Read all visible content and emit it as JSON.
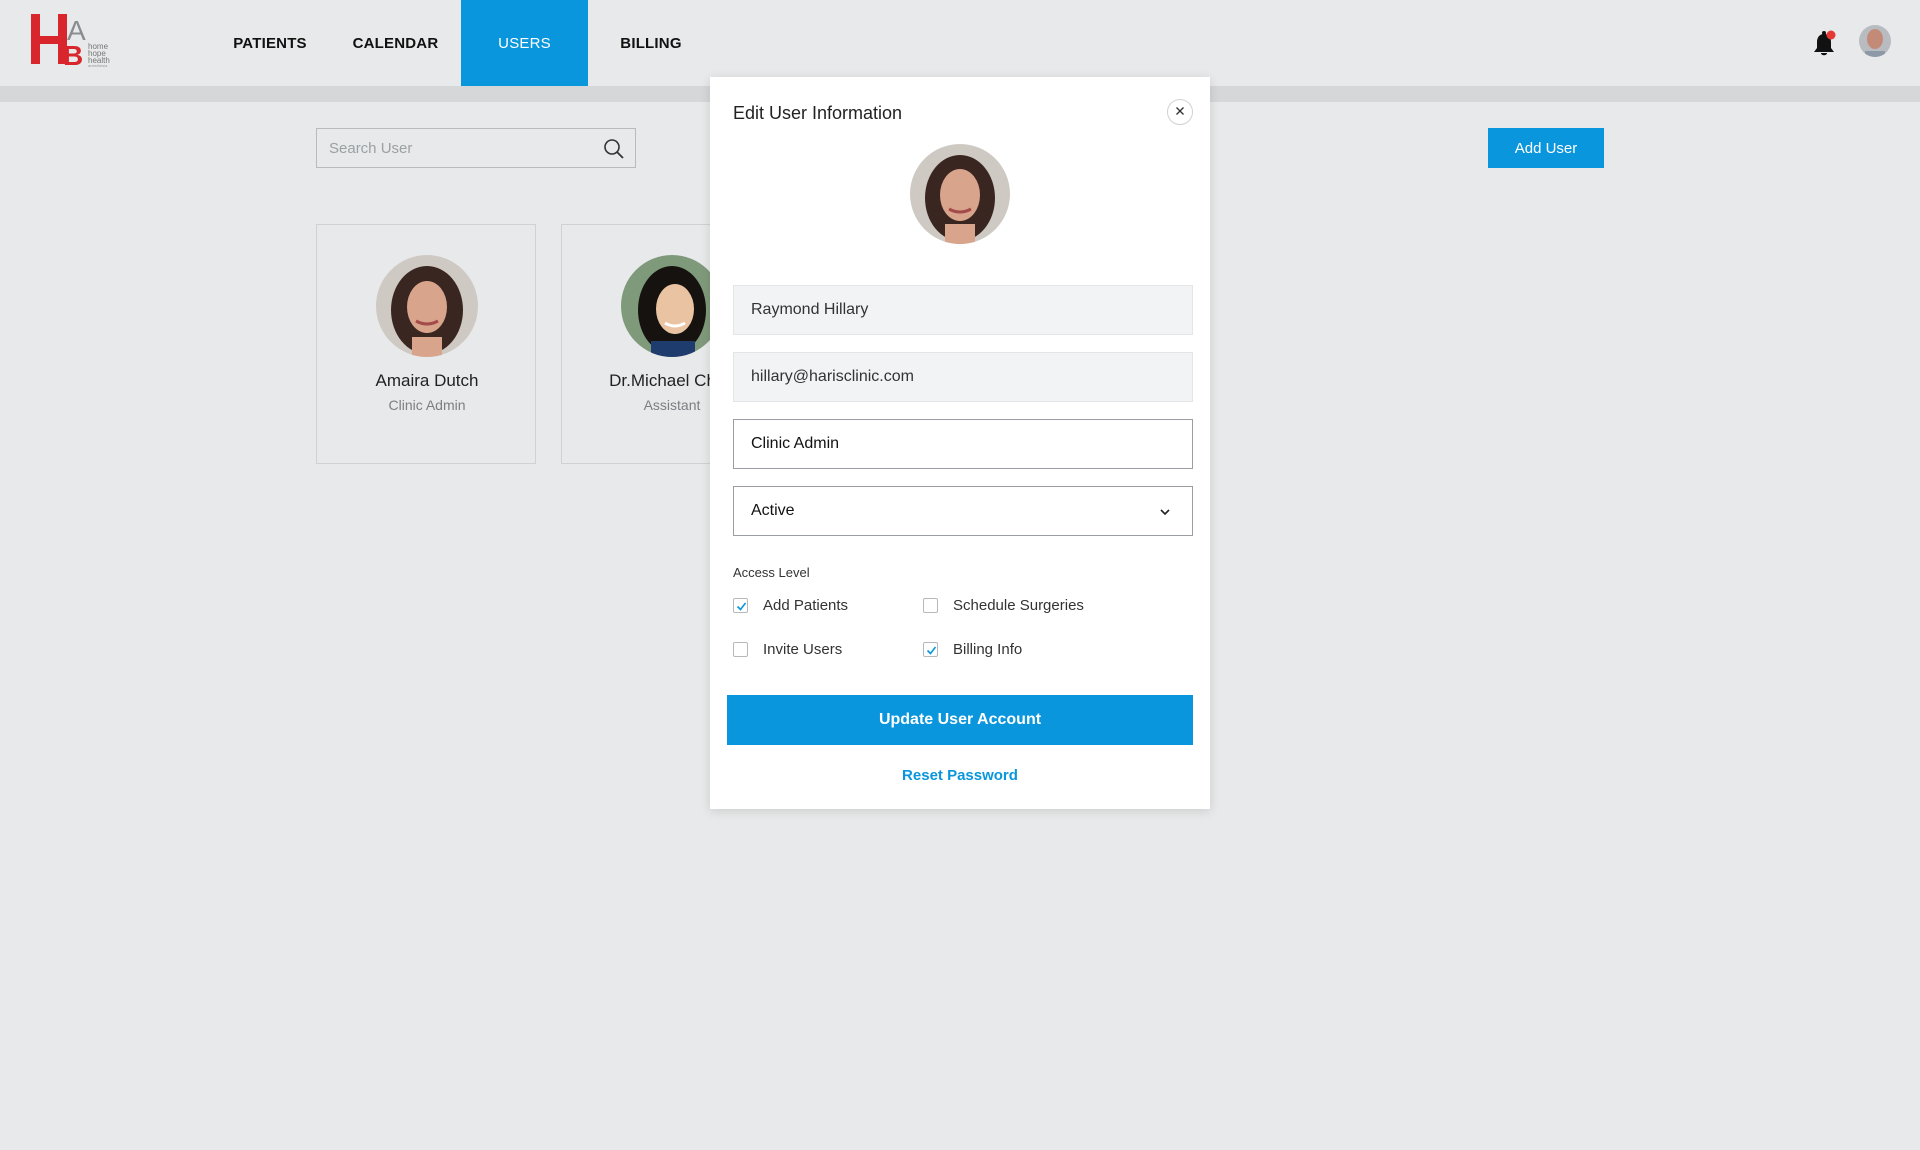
{
  "header": {
    "logo_alt": "home hope health",
    "nav": [
      {
        "label": "PATIENTS",
        "active": false
      },
      {
        "label": "CALENDAR",
        "active": false
      },
      {
        "label": "USERS",
        "active": true
      },
      {
        "label": "BILLING",
        "active": false
      }
    ],
    "notification_icon": "bell-icon",
    "notification_dot_color": "#e53935"
  },
  "search": {
    "placeholder": "Search User",
    "value": ""
  },
  "add_user_label": "Add User",
  "users": [
    {
      "name": "Amaira Dutch",
      "role": "Clinic Admin"
    },
    {
      "name": "Dr.Michael Chen",
      "role": "Assistant"
    }
  ],
  "modal": {
    "title": "Edit User Information",
    "name_value": "Raymond Hillary",
    "email_value": "hillary@harisclinic.com",
    "role_value": "Clinic Admin",
    "status_value": "Active",
    "access_label": "Access Level",
    "permissions": [
      {
        "label": "Add Patients",
        "checked": true
      },
      {
        "label": "Schedule Surgeries",
        "checked": false
      },
      {
        "label": "Invite Users",
        "checked": false
      },
      {
        "label": "Billing Info",
        "checked": true
      }
    ],
    "update_label": "Update User Account",
    "reset_label": "Reset Password"
  },
  "colors": {
    "accent": "#0a96dc",
    "brand_red": "#d8262c",
    "background": "#e8e9ea"
  }
}
